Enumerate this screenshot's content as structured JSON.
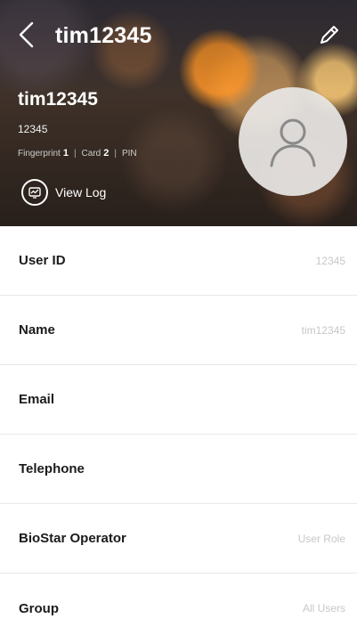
{
  "header": {
    "title": "tim12345",
    "back_icon": "chevron-left-icon",
    "edit_icon": "pencil-icon"
  },
  "profile": {
    "name": "tim12345",
    "id": "12345",
    "credentials": {
      "fingerprint_label": "Fingerprint",
      "fingerprint_count": "1",
      "card_label": "Card",
      "card_count": "2",
      "pin_label": "PIN",
      "separator": "|"
    },
    "view_log_label": "View Log",
    "avatar_icon": "user-placeholder-icon"
  },
  "fields": [
    {
      "label": "User ID",
      "value": "12345"
    },
    {
      "label": "Name",
      "value": "tim12345"
    },
    {
      "label": "Email",
      "value": ""
    },
    {
      "label": "Telephone",
      "value": ""
    },
    {
      "label": "BioStar Operator",
      "value": "User Role"
    },
    {
      "label": "Group",
      "value": "All Users"
    }
  ],
  "colors": {
    "row_label": "#1b1b1b",
    "row_value": "#c7c7c7",
    "divider": "#e8e8e8",
    "header_text": "#ffffff"
  }
}
